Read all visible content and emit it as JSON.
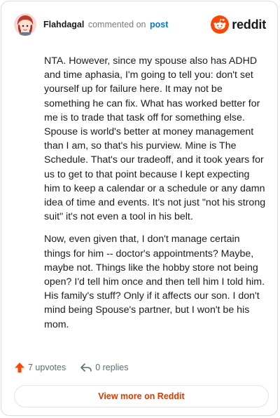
{
  "header": {
    "username": "Flahdagal",
    "action_text": "commented on",
    "target_link": "post",
    "brand_name": "reddit"
  },
  "comment": {
    "paragraphs": [
      "NTA. However, since my spouse also has ADHD and time aphasia, I'm going to tell you: don't set yourself up for failure here. It may not be something he can fix. What has worked better for me is to trade that task off for something else. Spouse is world's better at money management than I am, so that's his purview. Mine is The Schedule. That's our tradeoff, and it took years for us to get to that point because I kept expecting him to keep a calendar or a schedule or any damn idea of time and events. It's not just \"not his strong suit\" it's not even a tool in his belt.",
      "Now, even given that, I don't manage certain things for him -- doctor's appointments? Maybe, maybe not. Things like the hobby store not being open? I'd tell him once and then tell him I told him. His family's stuff? Only if it affects our son. I don't mind being Spouse's partner, but I won't be his mom."
    ]
  },
  "actions": {
    "upvotes_label": "7 upvotes",
    "replies_label": "0 replies"
  },
  "footer": {
    "view_more_label": "View more on Reddit"
  },
  "colors": {
    "upvote": "#ff4500",
    "link": "#0079d3",
    "view_more": "#d93a00"
  },
  "icons": [
    "avatar",
    "reddit-logo-icon",
    "upvote-arrow-icon",
    "reply-icon"
  ]
}
